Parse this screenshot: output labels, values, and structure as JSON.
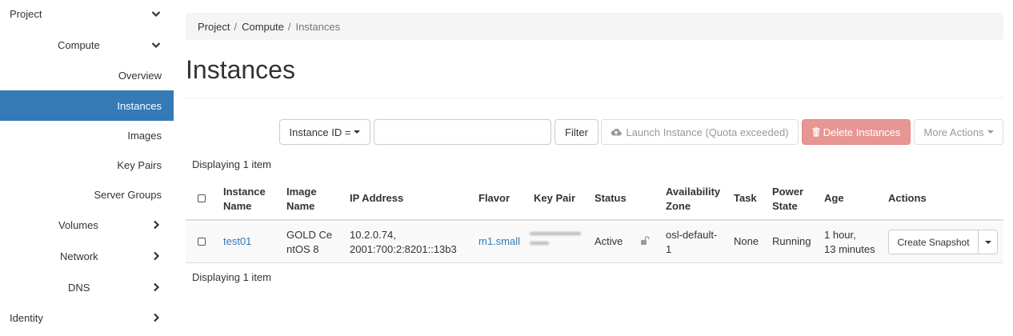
{
  "sidebar": {
    "project": "Project",
    "compute": "Compute",
    "overview": "Overview",
    "instances": "Instances",
    "images": "Images",
    "key_pairs": "Key Pairs",
    "server_groups": "Server Groups",
    "volumes": "Volumes",
    "network": "Network",
    "dns": "DNS",
    "identity": "Identity",
    "accent_color": "#337ab7"
  },
  "breadcrumb": {
    "items": [
      "Project",
      "Compute",
      "Instances"
    ],
    "separator": "/"
  },
  "page": {
    "title": "Instances"
  },
  "toolbar": {
    "filter_field": "Instance ID =",
    "filter_value": "",
    "filter_button": "Filter",
    "launch_button": "Launch Instance (Quota exceeded)",
    "delete_button": "Delete Instances",
    "more_actions": "More Actions",
    "delete_color": "#e89693"
  },
  "table": {
    "count_top": "Displaying 1 item",
    "count_bottom": "Displaying 1 item",
    "headers": {
      "name_1": "Instance",
      "name_2": "Name",
      "image_1": "Image",
      "image_2": "Name",
      "ip": "IP Address",
      "flavor": "Flavor",
      "key_pair": "Key Pair",
      "status": "Status",
      "az_1": "Availability",
      "az_2": "Zone",
      "task": "Task",
      "power_1": "Power",
      "power_2": "State",
      "age": "Age",
      "actions": "Actions"
    },
    "rows": [
      {
        "name": "test01",
        "image_1": "GOLD Ce",
        "image_2": "ntOS 8",
        "ip_1": "10.2.0.74,",
        "ip_2": "2001:700:2:8201::13b3",
        "flavor": "m1.small",
        "status": "Active",
        "az_1": "osl-default-",
        "az_2": "1",
        "task": "None",
        "power": "Running",
        "age_1": "1 hour,",
        "age_2": "13 minutes",
        "action": "Create Snapshot"
      }
    ]
  }
}
